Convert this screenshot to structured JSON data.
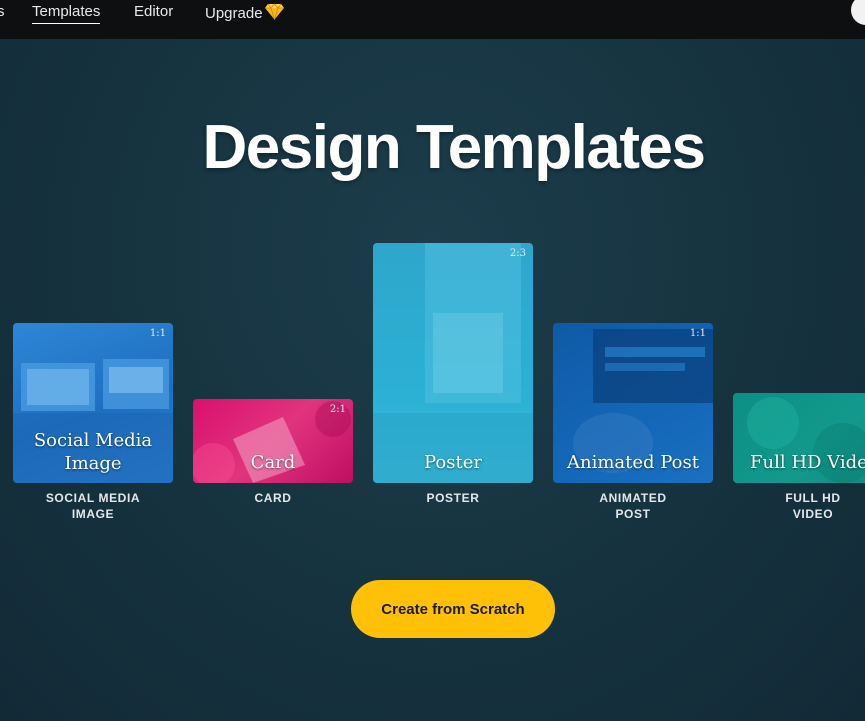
{
  "nav": {
    "fragment": "s",
    "items": [
      "Templates",
      "Editor",
      "Upgrade"
    ],
    "active": "Templates"
  },
  "hero": {
    "title": "Design Templates"
  },
  "templates": [
    {
      "card_label_l1": "Social Media",
      "card_label_l2": "Image",
      "ratio": "1:1",
      "caption_l1": "SOCIAL MEDIA",
      "caption_l2": "IMAGE",
      "color": "#2478c9"
    },
    {
      "card_label": "Card",
      "ratio": "2:1",
      "caption": "CARD",
      "color": "#d9106f"
    },
    {
      "card_label": "Poster",
      "ratio": "2:3",
      "caption": "POSTER",
      "color": "#2fa6cc"
    },
    {
      "card_label": "Animated Post",
      "ratio": "1:1",
      "caption_l1": "ANIMATED",
      "caption_l2": "POST",
      "color": "#1467b8"
    },
    {
      "card_label": "Full HD Video",
      "caption_l1": "FULL HD",
      "caption_l2": "VIDEO",
      "color": "#13998c"
    }
  ],
  "cta": {
    "label": "Create from Scratch",
    "color": "#ffc107"
  },
  "icons": {
    "upgrade": "diamond-icon",
    "account": "avatar"
  }
}
